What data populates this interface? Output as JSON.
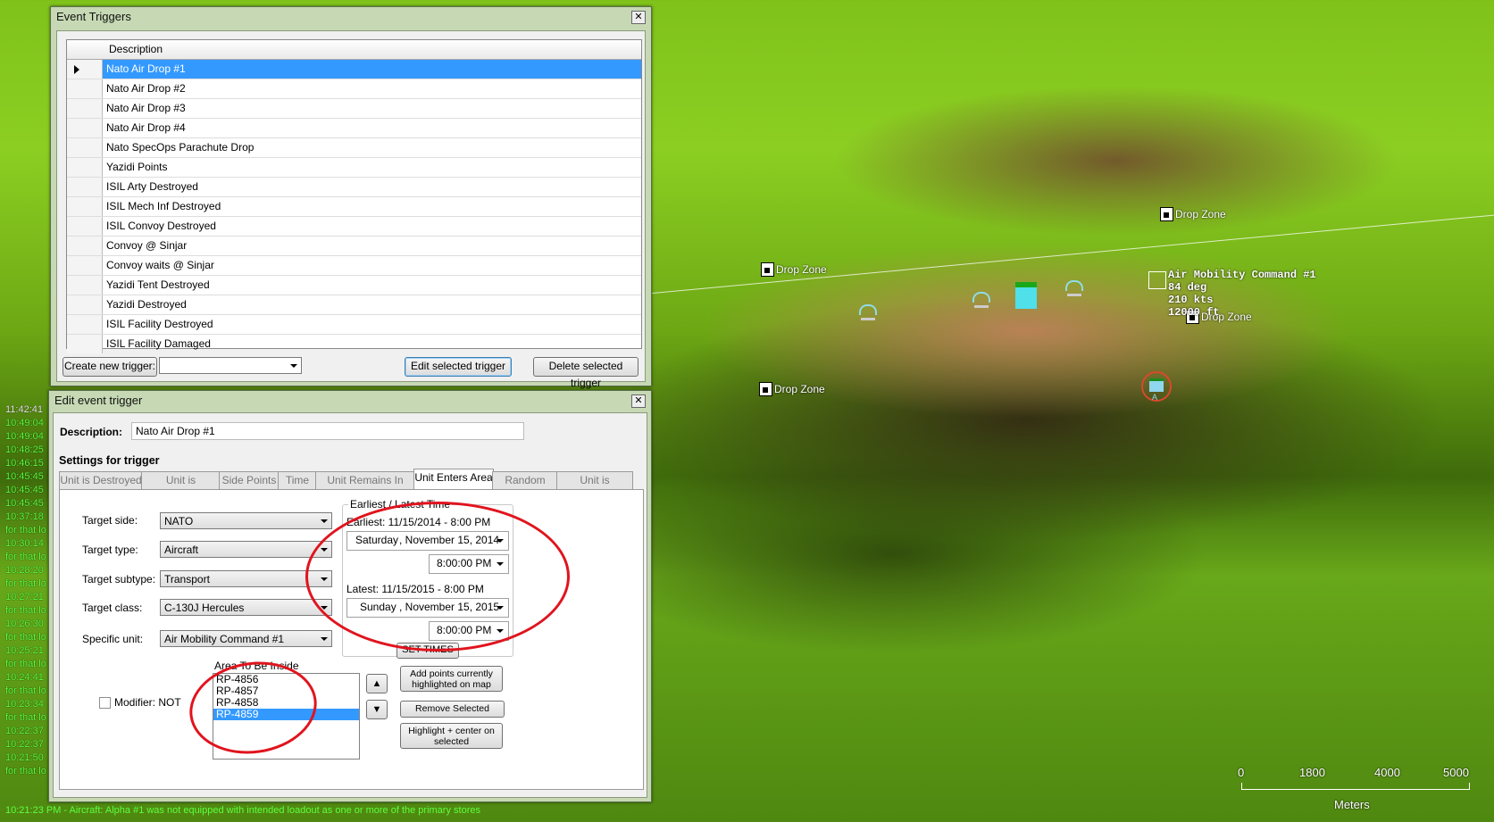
{
  "map": {
    "drop_zone_label": "Drop Zone",
    "aircraft_label": [
      "Air Mobility Command #1",
      "84 deg",
      "210 kts",
      "12000 ft"
    ],
    "scale_ticks": [
      "0",
      "1800",
      "4000",
      "5000"
    ],
    "scale_unit": "Meters",
    "enemy_marker_letter": "A"
  },
  "log": {
    "entries": [
      {
        "time": "11:42:41",
        "text": ""
      },
      {
        "time": "10:49:04",
        "text": ""
      },
      {
        "time": "10:49:04",
        "text": ""
      },
      {
        "time": "10:48:25",
        "text": ""
      },
      {
        "time": "10:46:15",
        "text": ""
      },
      {
        "time": "10:45:45",
        "text": ""
      },
      {
        "time": "10:45:45",
        "text": ""
      },
      {
        "time": "10:45:45",
        "text": ""
      },
      {
        "time": "10:37:18",
        "text": "for that lo"
      },
      {
        "time": "10:30:14",
        "text": "for that lo"
      },
      {
        "time": "10:28:20",
        "text": "for that lo"
      },
      {
        "time": "10:27:21",
        "text": "for that lo"
      },
      {
        "time": "10:26:30",
        "text": "for that lo"
      },
      {
        "time": "10:25:21",
        "text": "for that lo"
      },
      {
        "time": "10:24:41",
        "text": "for that lo"
      },
      {
        "time": "10:23:34",
        "text": "for that lo"
      },
      {
        "time": "10:22:37",
        "text": ""
      },
      {
        "time": "10:22:37",
        "text": ""
      },
      {
        "time": "10:21:50",
        "text": "for that lo"
      }
    ],
    "bottom_message": "10:21:23 PM - Aircraft: Alpha #1 was not equipped with intended loadout as one or more of the primary stores"
  },
  "event_triggers": {
    "title": "Event Triggers",
    "column_header": "Description",
    "rows": [
      "Nato Air Drop #1",
      "Nato Air Drop #2",
      "Nato Air Drop #3",
      "Nato Air Drop #4",
      "Nato SpecOps Parachute Drop",
      "Yazidi Points",
      "ISIL Arty Destroyed",
      "ISIL Mech Inf Destroyed",
      "ISIL Convoy Destroyed",
      "Convoy @ Sinjar",
      "Convoy waits @ Sinjar",
      "Yazidi Tent Destroyed",
      "Yazidi Destroyed",
      "ISIL Facility Destroyed",
      "ISIL Facility Damaged"
    ],
    "create_label": "Create new trigger:",
    "create_type_value": "",
    "edit_label": "Edit selected trigger",
    "delete_label": "Delete selected trigger"
  },
  "edit_trigger": {
    "title": "Edit event trigger",
    "description_label": "Description:",
    "description_value": "Nato Air Drop #1",
    "settings_heading": "Settings for trigger",
    "tabs": [
      "Unit is Destroyed",
      "Unit is Damaged",
      "Side Points",
      "Time",
      "Unit Remains In Area",
      "Unit Enters Area",
      "Random Time",
      "Unit is Detected"
    ],
    "active_tab": "Unit Enters Area",
    "fields": {
      "target_side_label": "Target side:",
      "target_side_value": "NATO",
      "target_type_label": "Target type:",
      "target_type_value": "Aircraft",
      "target_subtype_label": "Target subtype:",
      "target_subtype_value": "Transport",
      "target_class_label": "Target class:",
      "target_class_value": "C-130J Hercules",
      "specific_unit_label": "Specific unit:",
      "specific_unit_value": "Air Mobility Command #1"
    },
    "time_window": {
      "group_label": "Earliest / Latest Time",
      "earliest_label": "Earliest: 11/15/2014 - 8:00 PM",
      "earliest_day": "Saturday",
      "earliest_date": ", November 15, 2014",
      "earliest_time": "8:00:00 PM",
      "latest_label": "Latest: 11/15/2015 - 8:00 PM",
      "latest_day": "Sunday",
      "latest_date": ", November 15, 2015",
      "latest_time": "8:00:00 PM",
      "set_times_label": "SET TIMES"
    },
    "area": {
      "group_label": "Area To Be Inside",
      "points": [
        "RP-4856",
        "RP-4857",
        "RP-4858",
        "RP-4859"
      ],
      "selected_point": "RP-4859",
      "add_label": "Add points currently highlighted on map",
      "remove_label": "Remove Selected",
      "highlight_label": "Highlight + center on selected"
    },
    "modifier_label": "Modifier: NOT",
    "modifier_checked": false
  },
  "colors": {
    "selection": "#3399ff",
    "annotation_red": "#e0141e",
    "log_green": "#5cff3f",
    "window_frame": "#c6d9b4"
  }
}
